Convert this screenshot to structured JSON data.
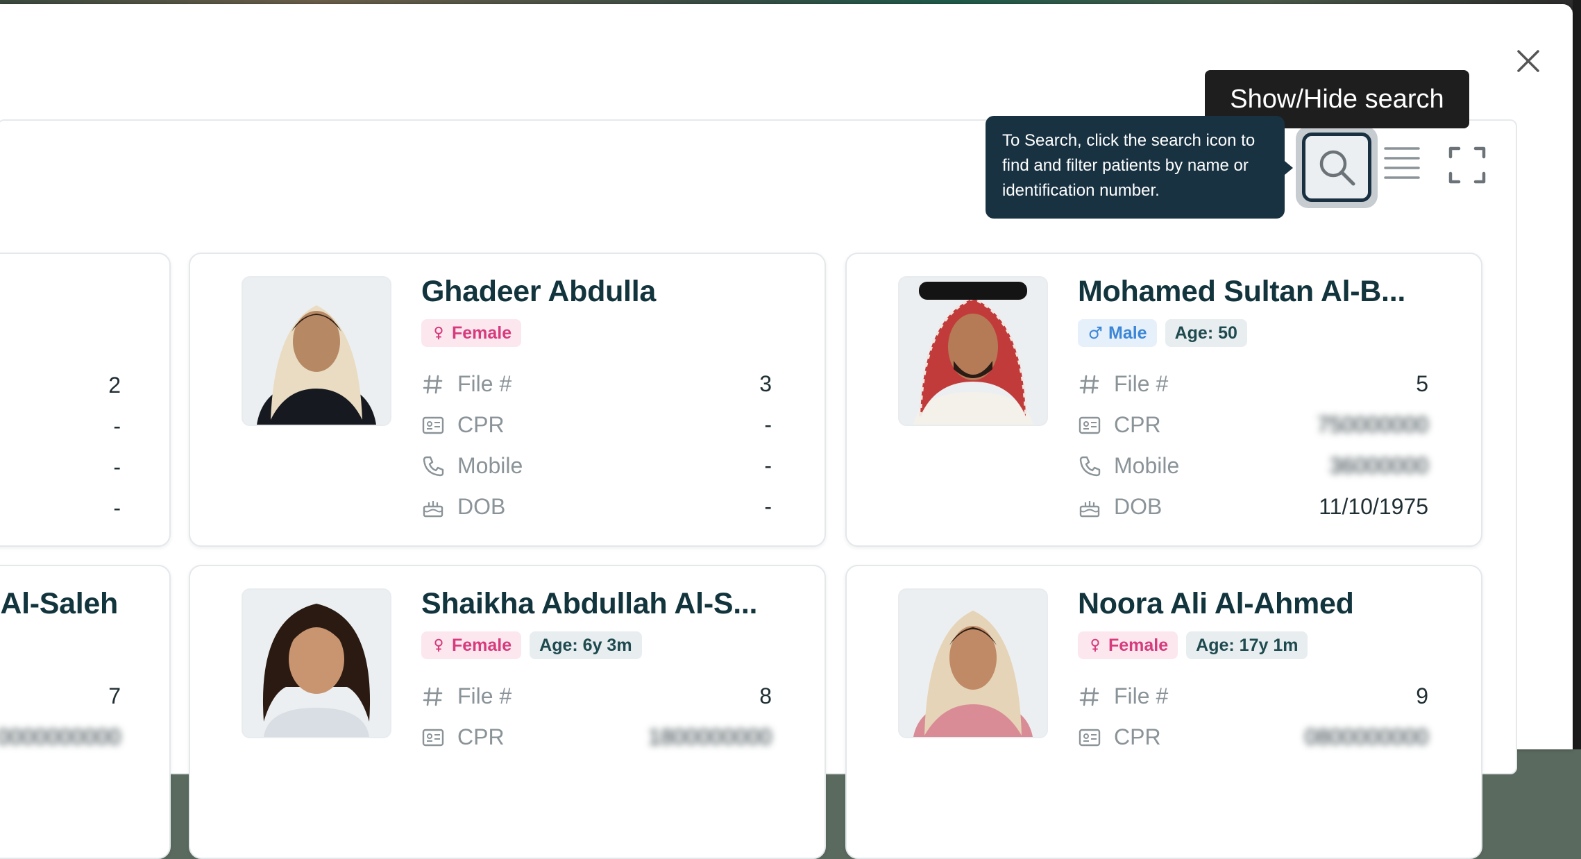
{
  "tooltip": {
    "show_hide_search": "Show/Hide search"
  },
  "search_hint": {
    "text": "To Search, click the search icon to find and filter patients by name or identification number."
  },
  "icons": {
    "close": "close-icon",
    "search": "search-icon",
    "list": "list-icon",
    "expand": "fullscreen-icon",
    "hash": "hash-icon",
    "id_card": "id-card-icon",
    "phone": "phone-icon",
    "cake": "cake-icon",
    "female": "female-icon",
    "male": "male-icon"
  },
  "labels": {
    "file": "File #",
    "cpr": "CPR",
    "mobile": "Mobile",
    "dob": "DOB"
  },
  "patients": [
    {
      "name": "",
      "gender": "",
      "age": "",
      "file": "2",
      "cpr": "-",
      "mobile": "-",
      "dob": "-"
    },
    {
      "name": "Ghadeer Abdulla",
      "gender": "Female",
      "age": "",
      "file": "3",
      "cpr": "-",
      "mobile": "-",
      "dob": "-"
    },
    {
      "name": "Mohamed Sultan Al-B...",
      "gender": "Male",
      "age": "Age: 50",
      "file": "5",
      "cpr": "750000000",
      "mobile": "36000000",
      "dob": "11/10/1975"
    },
    {
      "name": "Al-Saleh",
      "gender": "",
      "age": "",
      "file": "7",
      "cpr": "0000000000"
    },
    {
      "name": "Shaikha Abdullah Al-S...",
      "gender": "Female",
      "age": "Age: 6y 3m",
      "file": "8",
      "cpr": "1800000000"
    },
    {
      "name": "Noora Ali Al-Ahmed",
      "gender": "Female",
      "age": "Age: 17y 1m",
      "file": "9",
      "cpr": "0800000000"
    }
  ],
  "colors": {
    "primary_dark": "#12343d",
    "female": "#d63c7d",
    "male": "#3b86d6",
    "hint_bg": "#193242"
  }
}
